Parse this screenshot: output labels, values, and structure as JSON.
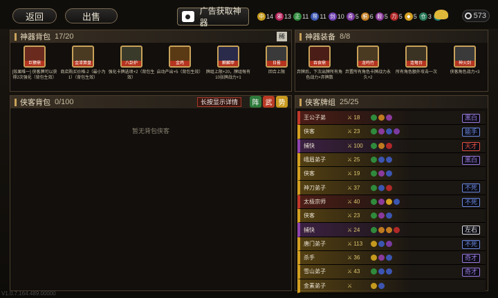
{
  "topbar": {
    "back_label": "返回",
    "sell_label": "出售",
    "ad_label": "广告获取神器",
    "resources": [
      {
        "icon": "中",
        "value": "14",
        "color": "#c59a1f"
      },
      {
        "icon": "邪",
        "value": "13",
        "color": "#b3245a"
      },
      {
        "icon": "正",
        "value": "11",
        "color": "#2f8a3c"
      },
      {
        "icon": "帮",
        "value": "11",
        "color": "#3b55b0"
      },
      {
        "icon": "剑",
        "value": "10",
        "color": "#6d3fb0"
      },
      {
        "icon": "奇",
        "value": "5",
        "color": "#7a3aa0"
      },
      {
        "icon": "酮",
        "value": "6",
        "color": "#c07a20"
      },
      {
        "icon": "毅",
        "value": "5",
        "color": "#8a3a9a"
      },
      {
        "icon": "力",
        "value": "5",
        "color": "#b02828"
      },
      {
        "icon": "◆",
        "value": "5",
        "color": "#d4a020"
      },
      {
        "icon": "仓",
        "value": "3",
        "color": "#2a7a5a"
      },
      {
        "icon": "帝",
        "value": "2",
        "color": "#20807a"
      }
    ],
    "currency_value": "573"
  },
  "artifact_bag": {
    "title": "神器背包",
    "count": "17/20",
    "sort_label": "稀",
    "cards": [
      {
        "tag": "巨獠鼎",
        "desc": "[效果唯一] 侠客牌可以获得2次强化（背包生效）",
        "art": "#6b2a1e"
      },
      {
        "tag": "金漆算盘",
        "desc": "商店购买价格-2（最小为1）（背包生效）",
        "art": "#4a3a22"
      },
      {
        "tag": "八卦炉",
        "desc": "强化卡牌选项+2（背包生效）",
        "art": "#3a3a2a"
      },
      {
        "tag": "金鸡",
        "desc": "启动产出+5（背包生效）",
        "art": "#5a3a14"
      },
      {
        "tag": "麒麟甲",
        "desc": "牌组上限+20，牌组每有10张牌战力+1",
        "art": "#2a2a4a"
      },
      {
        "tag": "日晷",
        "desc": "回合上限",
        "art": "#3a3a3a"
      }
    ]
  },
  "artifact_equip": {
    "title": "神器装备",
    "count": "8/8",
    "cards": [
      {
        "tag": "吞食鼎",
        "desc": "弃牌后，下次出牌所有角色战力×弃牌数",
        "art": "#4a1e16"
      },
      {
        "tag": "龙鸣竹",
        "desc": "弃置所有角色卡牌战力永久+2",
        "art": "#4a3a22"
      },
      {
        "tag": "连弩台",
        "desc": "所有角色额外攻击一次",
        "art": "#3a3222"
      },
      {
        "tag": "神火剑",
        "desc": "侠客角色战力+3",
        "art": "#3a3a3a"
      }
    ]
  },
  "hero_bag": {
    "title": "侠客背包",
    "count": "0/100",
    "detail_label": "长按显示详情",
    "factions": [
      {
        "label": "阵",
        "color": "#2f7a3c"
      },
      {
        "label": "武",
        "color": "#b83a24"
      },
      {
        "label": "势",
        "color": "#c89a1f"
      }
    ],
    "empty_text": "暂无背包侠客"
  },
  "hero_deck": {
    "title": "侠客牌组",
    "count": "25/25",
    "rows": [
      {
        "name": "王公子弟",
        "power": "18",
        "trait": "黑白",
        "rarity": "#c0392b",
        "trait_color": "#9a7ae0",
        "icons": [
          "#2f8a3c",
          "#c07a20",
          "#8a3a9a"
        ]
      },
      {
        "name": "侠客",
        "power": "23",
        "trait": "能手",
        "rarity": "#d4a020",
        "trait_color": "#6a8ae0",
        "icons": [
          "#2f8a3c",
          "#8a3a9a",
          "#3b55b0",
          "#7a3aa0"
        ]
      },
      {
        "name": "捕快",
        "power": "100",
        "trait": "天才",
        "rarity": "#8e44ad",
        "trait_color": "#e05040",
        "icons": [
          "#2f8a3c",
          "#c07a20",
          "#b02828"
        ]
      },
      {
        "name": "峨眉弟子",
        "power": "25",
        "trait": "黑白",
        "rarity": "#d4a020",
        "trait_color": "#9a7ae0",
        "icons": [
          "#2f8a3c",
          "#3b55b0",
          "#3b55b0"
        ]
      },
      {
        "name": "侠客",
        "power": "19",
        "trait": "",
        "rarity": "#d4a020",
        "trait_color": "#888888",
        "icons": [
          "#2f8a3c",
          "#8a3a9a",
          "#3b55b0"
        ]
      },
      {
        "name": "神刀弟子",
        "power": "37",
        "trait": "不死",
        "rarity": "#d4a020",
        "trait_color": "#6a8ae0",
        "icons": [
          "#2f8a3c",
          "#3b55b0",
          "#b02828"
        ]
      },
      {
        "name": "太极宗师",
        "power": "40",
        "trait": "不死",
        "rarity": "#c0392b",
        "trait_color": "#6a8ae0",
        "icons": [
          "#2f8a3c",
          "#8a3a9a",
          "#d4a020",
          "#3b55b0"
        ]
      },
      {
        "name": "侠客",
        "power": "23",
        "trait": "",
        "rarity": "#d4a020",
        "trait_color": "#888888",
        "icons": [
          "#2f8a3c",
          "#8a3a9a",
          "#3b55b0"
        ]
      },
      {
        "name": "捕快",
        "power": "24",
        "trait": "左右",
        "rarity": "#8e44ad",
        "trait_color": "#e0e0e0",
        "icons": [
          "#2f8a3c",
          "#c07a20",
          "#c07a20",
          "#b02828"
        ]
      },
      {
        "name": "唐门弟子",
        "power": "113",
        "trait": "不死",
        "rarity": "#d4a020",
        "trait_color": "#6a8ae0",
        "icons": [
          "#c59a1f",
          "#3b55b0",
          "#7a3aa0"
        ]
      },
      {
        "name": "杀手",
        "power": "36",
        "trait": "奇才",
        "rarity": "#d4a020",
        "trait_color": "#9a7ae0",
        "icons": [
          "#c59a1f",
          "#8a3a9a",
          "#3b55b0"
        ]
      },
      {
        "name": "雪山弟子",
        "power": "43",
        "trait": "奇才",
        "rarity": "#d4a020",
        "trait_color": "#9a7ae0",
        "icons": [
          "#2f8a3c",
          "#3b55b0",
          "#3b55b0"
        ]
      },
      {
        "name": "金素弟子",
        "power": "",
        "trait": "",
        "rarity": "#d4a020",
        "trait_color": "#888888",
        "icons": [
          "#c59a1f",
          "#3b55b0"
        ]
      }
    ]
  },
  "version_text": "V1.0.7.164.489.00000"
}
